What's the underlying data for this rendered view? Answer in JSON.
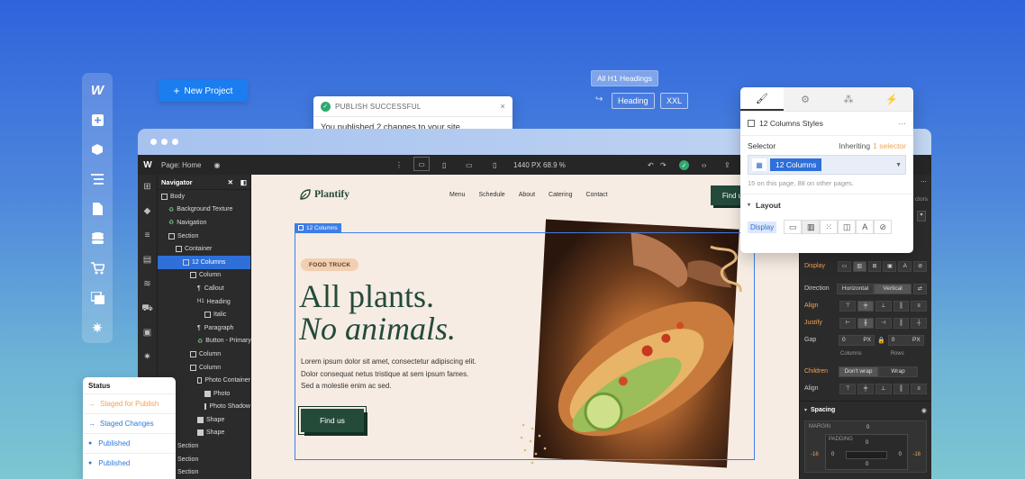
{
  "leftbar": {
    "logo": "W",
    "icons": [
      "add-icon",
      "cube-icon",
      "list-icon",
      "page-icon",
      "database-icon",
      "cart-icon",
      "assets-icon",
      "settings-icon"
    ]
  },
  "new_project": {
    "label": "New Project",
    "icon": "+"
  },
  "toast": {
    "title": "PUBLISH SUCCESSFUL",
    "message": "You published 2 changes to your site.",
    "close": "×"
  },
  "heading_tags": {
    "all_label": "All H1 Headings",
    "tag1": "Heading",
    "tag2": "XXL"
  },
  "designer": {
    "page_label": "Page: Home",
    "size": "1440 PX",
    "zoom": "68.9 %",
    "navigator_title": "Navigator",
    "tree": [
      {
        "label": "Body",
        "indent": 0,
        "kind": "box"
      },
      {
        "label": "Background Texture",
        "indent": 1,
        "kind": "comp"
      },
      {
        "label": "Navigation",
        "indent": 1,
        "kind": "comp"
      },
      {
        "label": "Section",
        "indent": 1,
        "kind": "box"
      },
      {
        "label": "Container",
        "indent": 2,
        "kind": "box"
      },
      {
        "label": "12 Columns",
        "indent": 3,
        "kind": "box",
        "selected": true
      },
      {
        "label": "Column",
        "indent": 4,
        "kind": "box"
      },
      {
        "label": "Callout",
        "indent": 5,
        "kind": "text"
      },
      {
        "label": "Heading",
        "indent": 5,
        "kind": "h"
      },
      {
        "label": "Italic",
        "indent": 6,
        "kind": "box"
      },
      {
        "label": "Paragraph",
        "indent": 5,
        "kind": "text"
      },
      {
        "label": "Button - Primary",
        "indent": 5,
        "kind": "comp"
      },
      {
        "label": "Column",
        "indent": 4,
        "kind": "box"
      },
      {
        "label": "Column",
        "indent": 4,
        "kind": "box"
      },
      {
        "label": "Photo Container",
        "indent": 5,
        "kind": "box"
      },
      {
        "label": "Photo",
        "indent": 6,
        "kind": "img"
      },
      {
        "label": "Photo Shadow",
        "indent": 6,
        "kind": "box"
      },
      {
        "label": "Shape",
        "indent": 5,
        "kind": "img"
      },
      {
        "label": "Shape",
        "indent": 5,
        "kind": "img"
      },
      {
        "label": "Section",
        "indent": 1,
        "kind": "box"
      },
      {
        "label": "Section",
        "indent": 1,
        "kind": "box"
      },
      {
        "label": "Section",
        "indent": 1,
        "kind": "box"
      }
    ]
  },
  "site": {
    "logo": "Plantify",
    "menu": [
      "Menu",
      "Schedule",
      "About",
      "Catering",
      "Contact"
    ],
    "find_us": "Find us",
    "selection_tag": "12 Columns",
    "badge": "FOOD TRUCK",
    "heading_line1": "All plants.",
    "heading_line2": "No animals.",
    "paragraph": "Lorem ipsum dolor sit amet, consectetur adipiscing elit. Dolor consequat netus tristique at sem ipsum fames. Sed a molestie enim ac sed.",
    "cta": "Find us"
  },
  "style_panel": {
    "styles_label": "12 Columns Styles",
    "more": "···",
    "selector_label": "Selector",
    "inheriting": "Inheriting",
    "inherit_count": "1 selector",
    "selector_value": "12 Columns",
    "usage_note": "15 on this page, 88 on other pages.",
    "layout_label": "Layout",
    "display_label": "Display"
  },
  "right_panel": {
    "display": "Display",
    "direction": "Direction",
    "horizontal": "Horizontal",
    "vertical": "Vertical",
    "align": "Align",
    "justify": "Justify",
    "gap": "Gap",
    "gap_col": "0",
    "gap_row": "0",
    "px": "PX",
    "columns": "Columns",
    "rows": "Rows",
    "children": "Children",
    "dont_wrap": "Don't wrap",
    "wrap": "Wrap",
    "align2": "Align",
    "spacing": "Spacing",
    "margin": "MARGIN",
    "padding": "PADDING",
    "margin_top": "0",
    "padding_top": "0",
    "m_left": "-16",
    "m_right": "-16",
    "p_left": "0",
    "p_right": "0",
    "p_bottom": "0",
    "ctors": "ctors"
  },
  "status": {
    "title": "Status",
    "items": [
      {
        "label": "Staged for Publish",
        "color": "#f3a255",
        "icon": "arrow-right-icon"
      },
      {
        "label": "Staged Changes",
        "color": "#2f7bd8",
        "icon": "arrow-right-icon"
      },
      {
        "label": "Published",
        "color": "#2f7bd8",
        "icon": "dot-icon"
      },
      {
        "label": "Published",
        "color": "#2f7bd8",
        "icon": "dot-icon"
      }
    ]
  }
}
